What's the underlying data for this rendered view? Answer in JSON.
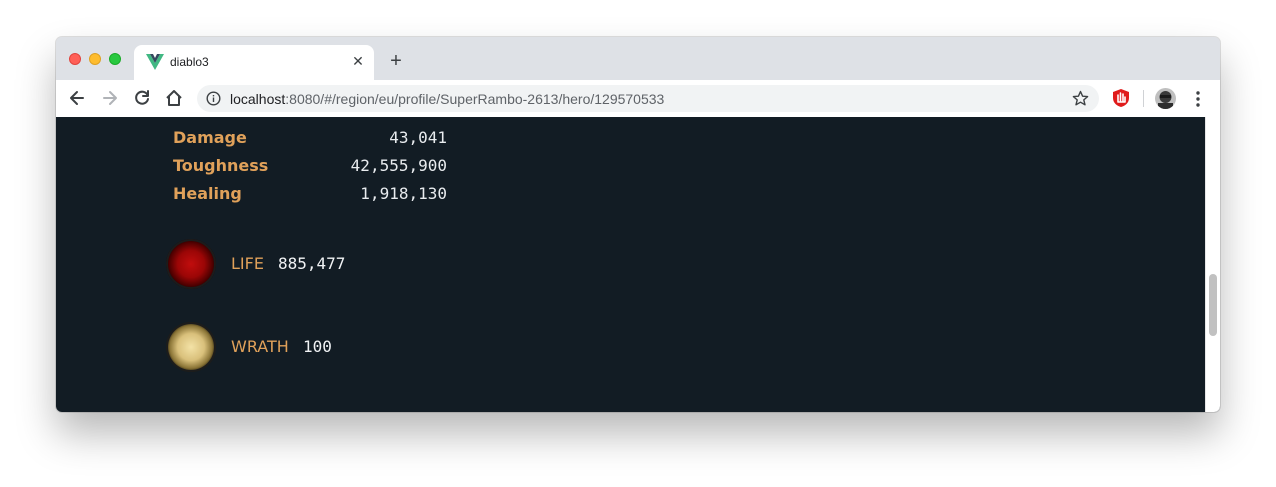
{
  "browser": {
    "tab_title": "diablo3",
    "url_host": "localhost",
    "url_rest": ":8080/#/region/eu/profile/SuperRambo-2613/hero/129570533",
    "colors": {
      "tabstrip": "#dee1e6",
      "accent_favicon": "#41b883"
    }
  },
  "stats": [
    {
      "label": "Damage",
      "value": "43,041"
    },
    {
      "label": "Toughness",
      "value": "42,555,900"
    },
    {
      "label": "Healing",
      "value": "1,918,130"
    }
  ],
  "resources": [
    {
      "label": "LIFE",
      "value": "885,477",
      "color": "#b00a0a"
    },
    {
      "label": "WRATH",
      "value": "100",
      "color": "#e6d08e"
    }
  ],
  "icons": {
    "back": "arrow-left-icon",
    "forward": "arrow-right-icon",
    "reload": "reload-icon",
    "home": "home-icon",
    "info": "info-icon",
    "bookmark": "star-icon",
    "extension": "ublock-icon",
    "profile": "avatar",
    "menu": "kebab-menu-icon"
  }
}
